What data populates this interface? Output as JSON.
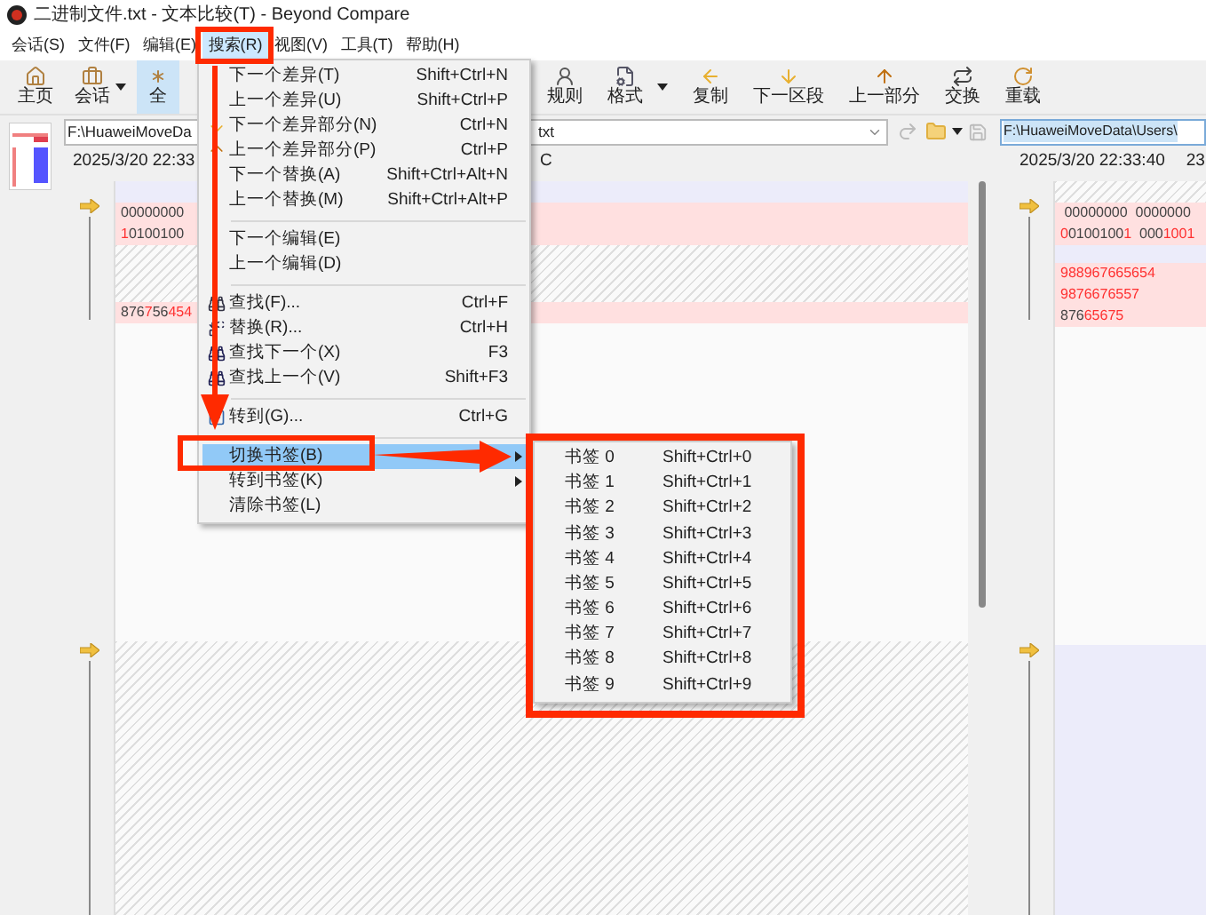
{
  "window": {
    "title": "二进制文件.txt - 文本比较(T) - Beyond Compare"
  },
  "menubar": [
    {
      "label": "会话(S)",
      "selected": false
    },
    {
      "label": "文件(F)",
      "selected": false
    },
    {
      "label": "编辑(E)",
      "selected": false
    },
    {
      "label": "搜索(R)",
      "selected": true
    },
    {
      "label": "视图(V)",
      "selected": false
    },
    {
      "label": "工具(T)",
      "selected": false
    },
    {
      "label": "帮助(H)",
      "selected": false
    }
  ],
  "toolbar_left": [
    {
      "label": "主页",
      "dropdown": false,
      "selected": false
    },
    {
      "label": "会话",
      "dropdown": true,
      "selected": false
    },
    {
      "label": "全",
      "dropdown": false,
      "selected": true
    }
  ],
  "toolbar_right": [
    {
      "label": "规则",
      "dropdown": false
    },
    {
      "label": "格式",
      "dropdown": true
    },
    {
      "label": "复制",
      "dropdown": false
    },
    {
      "label": "下一区段",
      "dropdown": false
    },
    {
      "label": "上一部分",
      "dropdown": false
    },
    {
      "label": "交换",
      "dropdown": false
    },
    {
      "label": "重载",
      "dropdown": false
    }
  ],
  "left_pane": {
    "path": "F:\\HuaweiMoveDa",
    "path_tail": "txt",
    "date": "2025/3/20 22:33",
    "date_tail": "C",
    "blocks": [
      {
        "kind": "changed"
      },
      {
        "kind": "diff",
        "lines": [
          [
            {
              "text": "00000000",
              "diff": false
            }
          ],
          [
            {
              "text": "1",
              "diff": true
            },
            {
              "text": "0100100",
              "diff": false
            }
          ]
        ]
      },
      {
        "kind": "missing"
      },
      {
        "kind": "diff",
        "lines": [
          [
            {
              "text": "876",
              "diff": false
            },
            {
              "text": "7",
              "diff": true
            },
            {
              "text": "56",
              "diff": false
            },
            {
              "text": "454",
              "diff": true
            }
          ]
        ]
      },
      {
        "kind": "blank"
      },
      {
        "kind": "missing"
      }
    ]
  },
  "right_pane": {
    "path": "F:\\HuaweiMoveData\\Users\\",
    "date": "2025/3/20 22:33:40",
    "date_tail": "23",
    "blocks": [
      {
        "kind": "missing"
      },
      {
        "kind": "diff",
        "lines": [
          [
            {
              "text": " 00000000  0000000",
              "diff": false
            }
          ],
          [
            {
              "text": "0",
              "diff": true
            },
            {
              "text": "0100100",
              "diff": false
            },
            {
              "text": "1",
              "diff": true
            },
            {
              "text": "  000",
              "diff": false
            },
            {
              "text": "1001",
              "diff": true
            }
          ]
        ]
      },
      {
        "kind": "changed"
      },
      {
        "kind": "diff",
        "lines": [
          [
            {
              "text": "988967665654",
              "diff": true
            }
          ],
          [
            {
              "text": "9876676557",
              "diff": true
            }
          ],
          [
            {
              "text": "876",
              "diff": false
            },
            {
              "text": "65675",
              "diff": true
            }
          ]
        ]
      },
      {
        "kind": "blank"
      },
      {
        "kind": "changed"
      }
    ]
  },
  "search_menu": {
    "groups": [
      [
        {
          "label": "下一个差异(T)",
          "shortcut": "Shift+Ctrl+N",
          "selected": false,
          "submenu": false
        },
        {
          "label": "上一个差异(U)",
          "shortcut": "Shift+Ctrl+P",
          "selected": false,
          "submenu": false
        },
        {
          "label": "下一个差异部分(N)",
          "shortcut": "Ctrl+N",
          "selected": false,
          "submenu": false
        },
        {
          "label": "上一个差异部分(P)",
          "shortcut": "Ctrl+P",
          "selected": false,
          "submenu": false
        },
        {
          "label": "下一个替换(A)",
          "shortcut": "Shift+Ctrl+Alt+N",
          "selected": false,
          "submenu": false
        },
        {
          "label": "上一个替换(M)",
          "shortcut": "Shift+Ctrl+Alt+P",
          "selected": false,
          "submenu": false
        }
      ],
      [
        {
          "label": "下一个编辑(E)",
          "selected": false,
          "submenu": false
        },
        {
          "label": "上一个编辑(D)",
          "selected": false,
          "submenu": false
        }
      ],
      [
        {
          "label": "查找(F)...",
          "shortcut": "Ctrl+F",
          "selected": false,
          "submenu": false
        },
        {
          "label": "替换(R)...",
          "shortcut": "Ctrl+H",
          "selected": false,
          "submenu": false
        },
        {
          "label": "查找下一个(X)",
          "shortcut": "F3",
          "selected": false,
          "submenu": false
        },
        {
          "label": "查找上一个(V)",
          "shortcut": "Shift+F3",
          "selected": false,
          "submenu": false
        }
      ],
      [
        {
          "label": "转到(G)...",
          "shortcut": "Ctrl+G",
          "selected": false,
          "submenu": false
        }
      ],
      [
        {
          "label": "切换书签(B)",
          "selected": true,
          "submenu": true
        },
        {
          "label": "转到书签(K)",
          "selected": false,
          "submenu": true
        },
        {
          "label": "清除书签(L)",
          "selected": false,
          "submenu": false
        }
      ]
    ]
  },
  "bookmark_submenu": [
    {
      "label": "书签 0",
      "shortcut": "Shift+Ctrl+0"
    },
    {
      "label": "书签 1",
      "shortcut": "Shift+Ctrl+1"
    },
    {
      "label": "书签 2",
      "shortcut": "Shift+Ctrl+2"
    },
    {
      "label": "书签 3",
      "shortcut": "Shift+Ctrl+3"
    },
    {
      "label": "书签 4",
      "shortcut": "Shift+Ctrl+4"
    },
    {
      "label": "书签 5",
      "shortcut": "Shift+Ctrl+5"
    },
    {
      "label": "书签 6",
      "shortcut": "Shift+Ctrl+6"
    },
    {
      "label": "书签 7",
      "shortcut": "Shift+Ctrl+7"
    },
    {
      "label": "书签 8",
      "shortcut": "Shift+Ctrl+8"
    },
    {
      "label": "书签 9",
      "shortcut": "Shift+Ctrl+9"
    }
  ]
}
